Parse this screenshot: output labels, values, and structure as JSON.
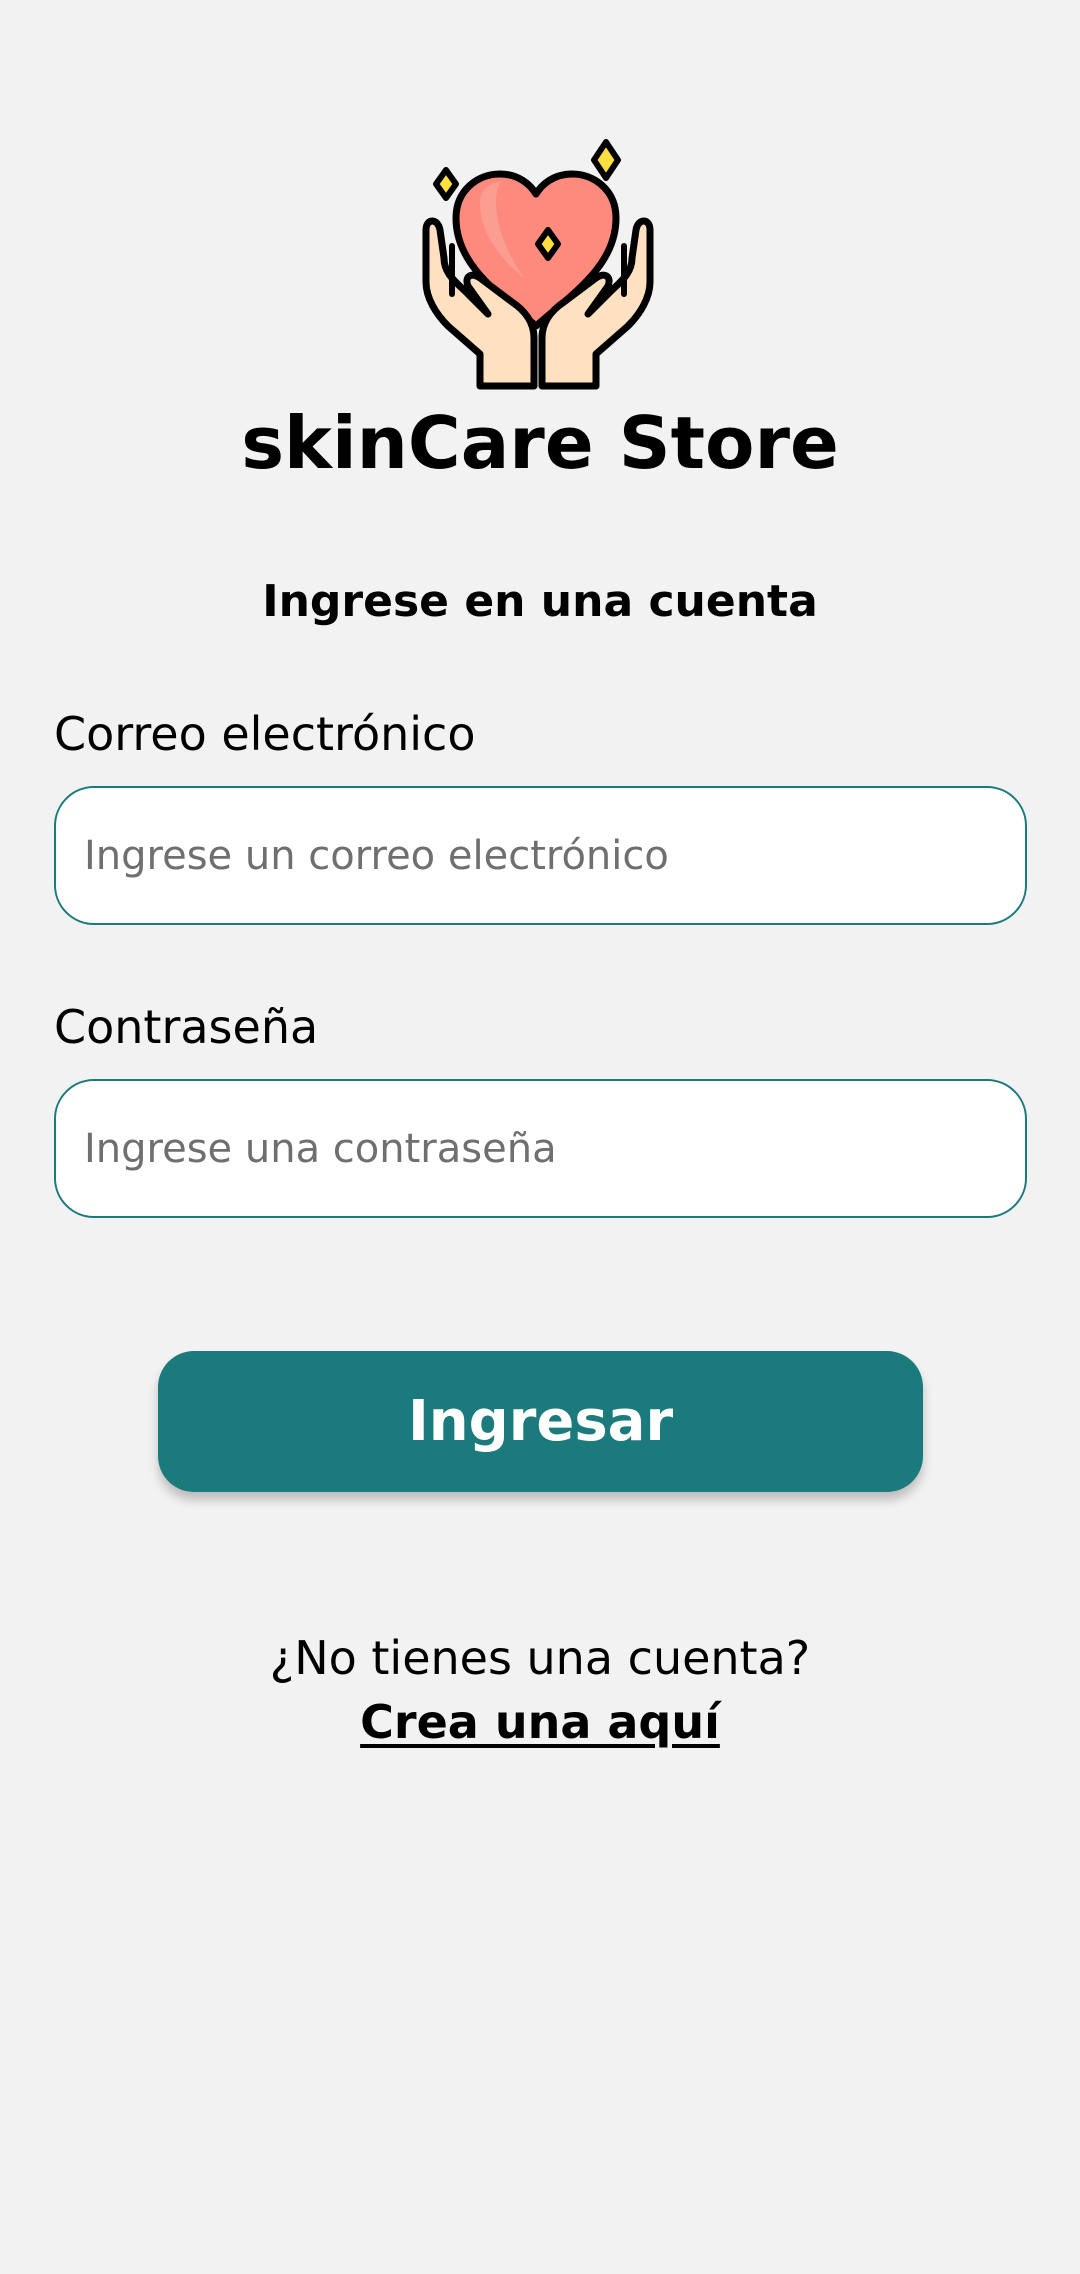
{
  "app": {
    "brand_name": "skinCare Store",
    "logo_icon": "heart-in-hands-icon"
  },
  "login": {
    "heading": "Ingrese en una cuenta",
    "email_label": "Correo electrónico",
    "email_value": "",
    "email_placeholder": "Ingrese un correo electrónico",
    "password_label": "Contraseña",
    "password_value": "",
    "password_placeholder": "Ingrese una contraseña",
    "submit_label": "Ingresar",
    "no_account_text": "¿No tienes una cuenta?",
    "create_account_link": "Crea una aquí"
  },
  "colors": {
    "background": "#f2f2f2",
    "accent": "#1a7a7c",
    "input_background": "#ffffff",
    "heart": "#fd8a7d",
    "sparkle": "#ffdf40",
    "skin": "#ffe1c2"
  }
}
